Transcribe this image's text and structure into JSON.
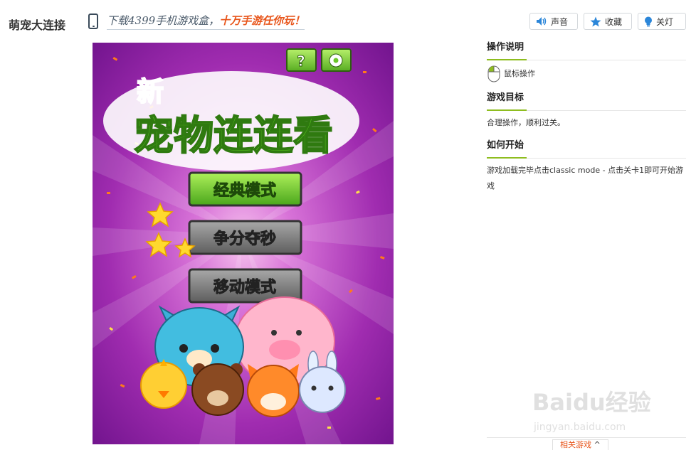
{
  "header": {
    "game_title": "萌宠大连接",
    "promo_prefix": "下载4399手机游戏盒，",
    "promo_highlight": "十万手游任你玩！"
  },
  "toolbar": {
    "sound_label": "声音",
    "favorite_label": "收藏",
    "lights_label": "关灯"
  },
  "game": {
    "logo_small": "新",
    "logo_main": "宠物连连看",
    "buttons": [
      {
        "label": "经典模式",
        "style": "green"
      },
      {
        "label": "争分夺秒",
        "style": "gray"
      },
      {
        "label": "移动模式",
        "style": "gray"
      }
    ],
    "help_icon": "?",
    "settings_icon": "gear-icon"
  },
  "sidebar": {
    "ops_title": "操作说明",
    "ops_mouse": "鼠标操作",
    "goal_title": "游戏目标",
    "goal_text": "合理操作，顺利过关。",
    "start_title": "如何开始",
    "start_text": "游戏加载完毕点击classic mode - 点击关卡1即可开始游戏"
  },
  "related": {
    "tab_label": "相关游戏"
  },
  "watermark": {
    "brand": "Baidu经验",
    "url": "jingyan.baidu.com"
  },
  "colors": {
    "accent_green": "#8ebd1f",
    "promo_orange": "#e8561c",
    "game_bg": "#a02cb0",
    "button_green": "#6cc62a",
    "button_gray": "#777777"
  }
}
